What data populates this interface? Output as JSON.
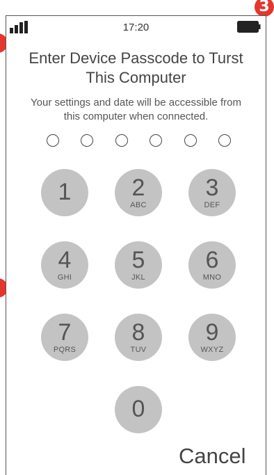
{
  "markers": {
    "top_right": "3"
  },
  "status_bar": {
    "time": "17:20",
    "signal_icon": "signal-bars-icon",
    "battery_icon": "battery-full-icon"
  },
  "prompt": {
    "title_line1": "Enter Device Passcode to Turst",
    "title_line2": "This Computer",
    "subtitle_line1": "Your settings and date will be accessible from",
    "subtitle_line2": "this computer when connected."
  },
  "passcode": {
    "length": 6,
    "filled": 0
  },
  "keypad": {
    "keys": [
      {
        "digit": "1",
        "letters": ""
      },
      {
        "digit": "2",
        "letters": "ABC"
      },
      {
        "digit": "3",
        "letters": "DEF"
      },
      {
        "digit": "4",
        "letters": "GHI"
      },
      {
        "digit": "5",
        "letters": "JKL"
      },
      {
        "digit": "6",
        "letters": "MNO"
      },
      {
        "digit": "7",
        "letters": "PQRS"
      },
      {
        "digit": "8",
        "letters": "TUV"
      },
      {
        "digit": "9",
        "letters": "WXYZ"
      },
      {
        "digit": "0",
        "letters": ""
      }
    ]
  },
  "actions": {
    "cancel_label": "Cancel"
  },
  "colors": {
    "key_fill": "#c3c3c3",
    "marker": "#e4362e",
    "text": "#444444"
  }
}
